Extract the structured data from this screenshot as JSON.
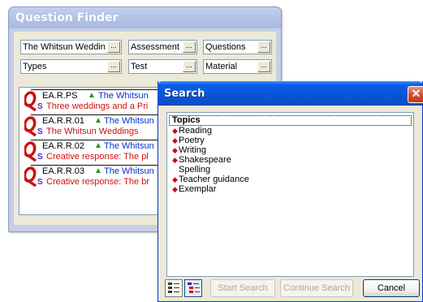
{
  "finder": {
    "title": "Question Finder",
    "filters": [
      {
        "value": "The Whitsun Weddings"
      },
      {
        "value": "Assessment"
      },
      {
        "value": "Questions"
      },
      {
        "value": "Types"
      },
      {
        "value": "Test"
      },
      {
        "value": "Material"
      }
    ],
    "button_glyph": "...",
    "questions": [
      {
        "code": "EA.R.PS",
        "triangle": "▲",
        "title": "The Whitsun",
        "s": "S",
        "desc": "Three weddings and a Pri"
      },
      {
        "code": "EA.R.R.01",
        "triangle": "▲",
        "title": "The Whitsun",
        "s": "S",
        "desc": "The Whitsun Weddings"
      },
      {
        "code": "EA.R.R.02",
        "triangle": "▲",
        "title": "The Whitsun",
        "s": "S",
        "desc": "Creative response: The pl"
      },
      {
        "code": "EA.R.R.03",
        "triangle": "▲",
        "title": "The Whitsun",
        "s": "S",
        "desc": "Creative response: The br"
      }
    ],
    "q_icon": "Q",
    "colors": {
      "code": "#000000",
      "title": "#0033cc",
      "desc": "#d01010",
      "triangle": "#1a9a1a",
      "q_icon": "#cc1111"
    }
  },
  "search": {
    "title": "Search",
    "close_glyph": "✕",
    "topics_header": "Topics",
    "topics": [
      {
        "label": "Reading",
        "bullet": true
      },
      {
        "label": "Poetry",
        "bullet": true
      },
      {
        "label": "Writing",
        "bullet": true
      },
      {
        "label": "Shakespeare",
        "bullet": true
      },
      {
        "label": "Spelling",
        "bullet": false
      },
      {
        "label": "Teacher guidance",
        "bullet": true
      },
      {
        "label": "Exemplar",
        "bullet": true
      }
    ],
    "bullet_glyph": "◆",
    "buttons": {
      "start": "Start Search",
      "continue": "Continue Search",
      "cancel": "Cancel"
    },
    "icons": [
      "list-view-icon",
      "tree-view-icon"
    ]
  }
}
